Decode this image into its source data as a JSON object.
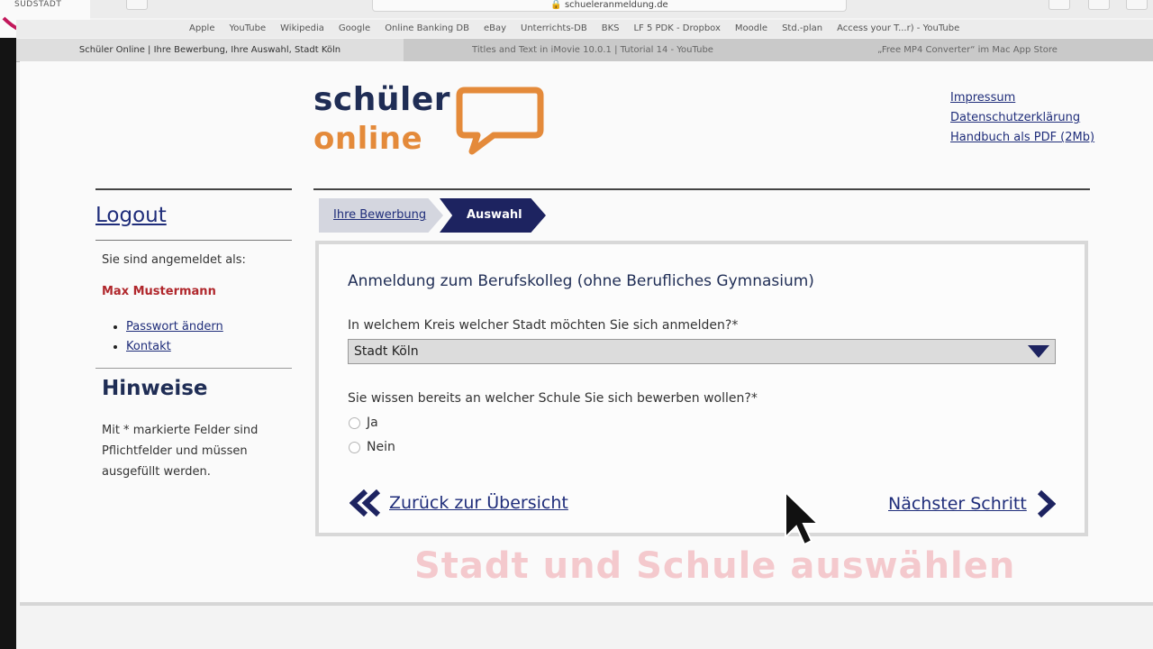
{
  "browser": {
    "url": "schueleranmeldung.de",
    "brand_corner": "SÜDSTADT",
    "bookmarks": [
      "Apple",
      "YouTube",
      "Wikipedia",
      "Google",
      "Online Banking DB",
      "eBay",
      "Unterrichts-DB",
      "BKS",
      "LF 5 PDK - Dropbox",
      "Moodle",
      "Std.-plan",
      "Access your T...r) - YouTube"
    ],
    "tabs": [
      {
        "label": "Schüler Online | Ihre Bewerbung, Ihre Auswahl, Stadt Köln",
        "active": true
      },
      {
        "label": "Titles and Text in iMovie 10.0.1 | Tutorial 14 - YouTube",
        "active": false
      },
      {
        "label": "„Free MP4 Converter“ im Mac App Store",
        "active": false
      }
    ]
  },
  "logo": {
    "line1": "schüler",
    "line2": "online"
  },
  "top_links": [
    "Impressum",
    "Datenschutzerklärung",
    "Handbuch als PDF (2Mb)"
  ],
  "sidebar": {
    "logout": "Logout",
    "signed_in_label": "Sie sind angemeldet als:",
    "user_name": "Max Mustermann",
    "links": [
      "Passwort ändern",
      "Kontakt"
    ],
    "hints_title": "Hinweise",
    "hints_text": "Mit * markierte Felder sind Pflichtfelder und müssen ausgefüllt werden."
  },
  "breadcrumb": {
    "step1": "Ihre Bewerbung",
    "step2": "Auswahl"
  },
  "form": {
    "title": "Anmeldung zum Berufskolleg (ohne Berufliches Gymnasium)",
    "question1": "In welchem Kreis welcher Stadt möchten Sie sich anmelden?*",
    "city_selected": "Stadt Köln",
    "question2": "Sie wissen bereits an welcher Schule Sie sich bewerben wollen?*",
    "option_yes": "Ja",
    "option_no": "Nein",
    "back_label": "Zurück zur Übersicht",
    "next_label": "Nächster Schritt"
  },
  "video_caption": "Stadt und Schule auswählen",
  "colors": {
    "navy": "#1d2360",
    "orange": "#e48a3a",
    "user_red": "#b0272c",
    "caption_pink": "#f4c9cd"
  }
}
